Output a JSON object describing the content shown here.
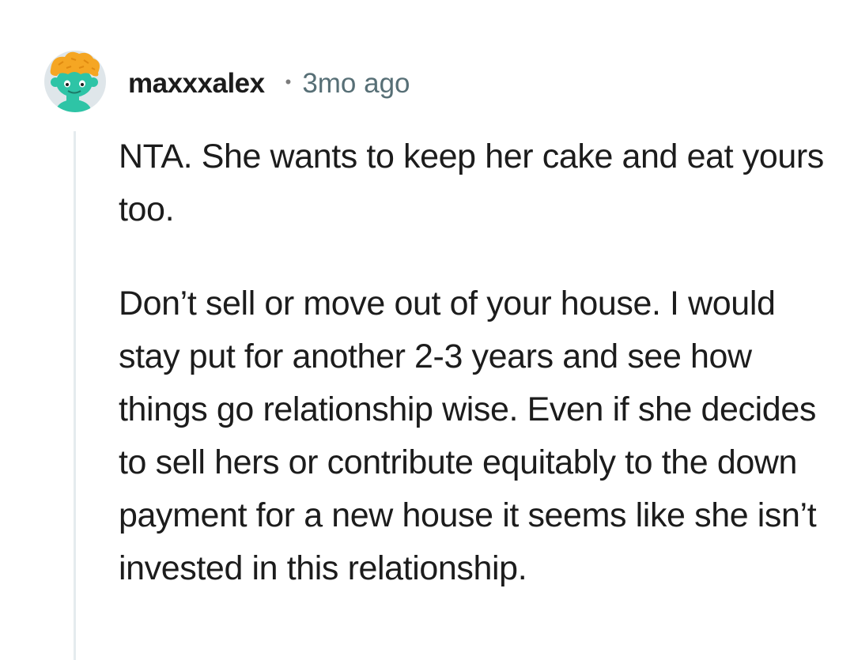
{
  "comment": {
    "author": {
      "username": "maxxxalex",
      "avatar_icon": "snoo-avatar-icon"
    },
    "separator": "•",
    "timestamp": "3mo ago",
    "paragraphs": [
      "NTA. She wants to keep her cake and eat yours too.",
      "Don’t sell or move out of your house. I would stay put for another 2-3 years and see how things go relationship wise. Even if she decides to sell hers or contribute equitably to the down payment for a new house it seems like she isn’t invested in this relationship."
    ]
  },
  "colors": {
    "background": "#ffffff",
    "text": "#1c1c1c",
    "meta": "#576f76",
    "thread_line": "#e5ebee",
    "avatar_body": "#2ec4a6",
    "avatar_hair": "#f5a623"
  }
}
